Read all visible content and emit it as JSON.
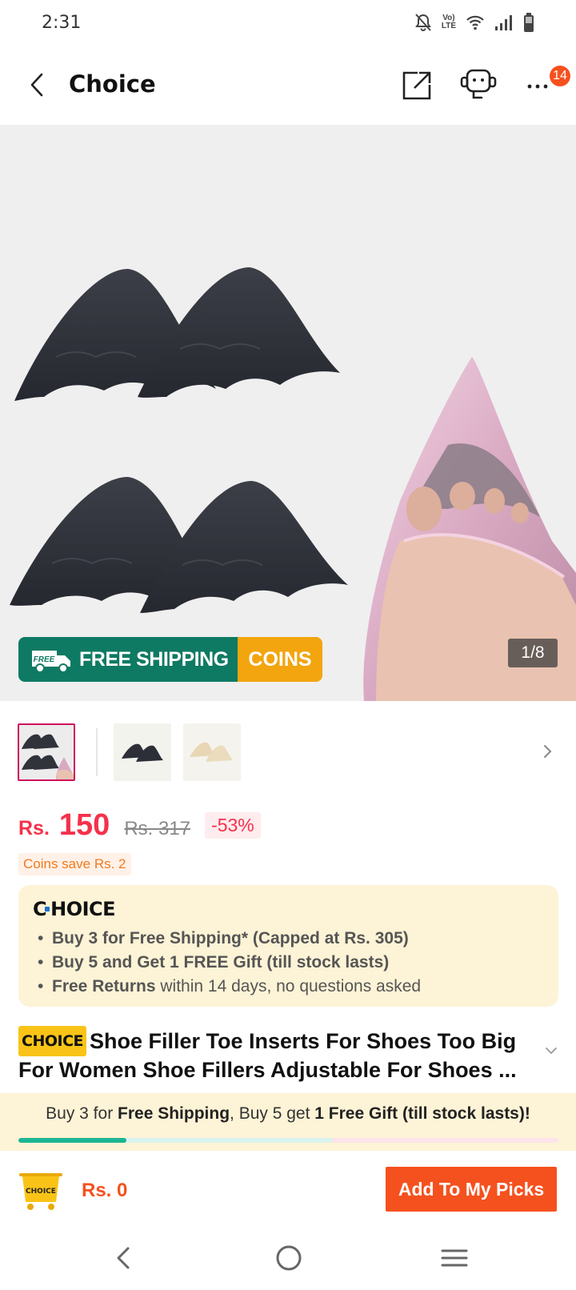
{
  "status_bar": {
    "time": "2:31",
    "volte_label": "Vo)) LTE"
  },
  "header": {
    "title": "Choice",
    "more_badge": "14"
  },
  "hero": {
    "counter": "1/8",
    "promo_free_shipping": "FREE SHIPPING",
    "promo_coins": "COINS",
    "truck_label": "FREE"
  },
  "price": {
    "currency": "Rs.",
    "current": "150",
    "original": "Rs. 317",
    "discount": "-53%",
    "coins_save": "Coins save Rs. 2"
  },
  "choice_box": {
    "logo": "CHOICE",
    "items": [
      {
        "bold": "Buy 3 for  Free Shipping* (Capped at Rs. 305)",
        "rest": ""
      },
      {
        "bold": "Buy 5 and Get 1 FREE Gift (till stock lasts)",
        "rest": ""
      },
      {
        "bold": "Free Returns",
        "rest": " within 14 days, no questions asked"
      }
    ]
  },
  "product": {
    "tag": "CHOICE",
    "title": "Shoe Filler Toe Inserts For Shoes Too Big For Women Shoe Fillers Adjustable For Shoes ..."
  },
  "ship_strip": {
    "p1": "Buy 3 for ",
    "b1": "Free Shipping",
    "p2": ", Buy 5 get ",
    "b2": "1 Free Gift (till stock lasts)!",
    "progress": 0.2
  },
  "action_bar": {
    "cart_label": "CHOICE",
    "total": "Rs. 0",
    "add_button": "Add To My Picks"
  },
  "colors": {
    "accent": "#f5511e",
    "price_red": "#f5314b",
    "choice_bg": "#fdf3d6",
    "promo_green": "#0f7a63",
    "promo_orange": "#f2a50f"
  }
}
